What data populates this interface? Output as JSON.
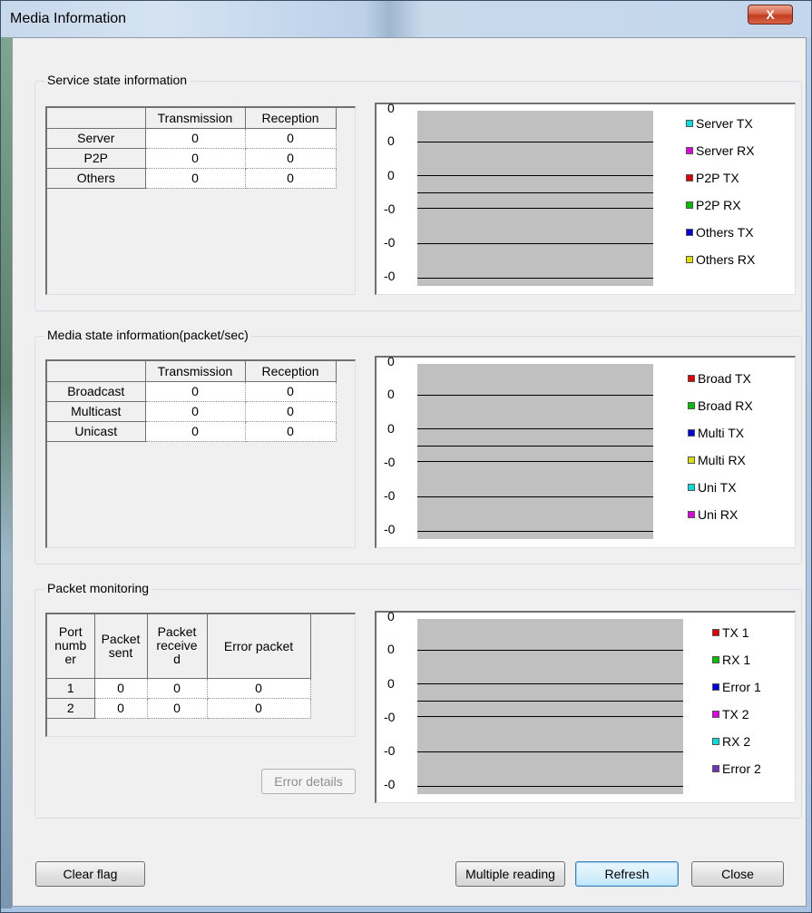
{
  "window": {
    "title": "Media Information",
    "close_glyph": "X"
  },
  "service": {
    "group_title": "Service state information",
    "col_headers": [
      "Transmission",
      "Reception"
    ],
    "rows": [
      {
        "label": "Server",
        "tx": "0",
        "rx": "0"
      },
      {
        "label": "P2P",
        "tx": "0",
        "rx": "0"
      },
      {
        "label": "Others",
        "tx": "0",
        "rx": "0"
      }
    ],
    "chart": {
      "yticks": [
        "0",
        "0",
        "0",
        "-0",
        "-0",
        "-0"
      ],
      "legend": [
        {
          "label": "Server TX",
          "color": "#00e0e0"
        },
        {
          "label": "Server RX",
          "color": "#e000e0"
        },
        {
          "label": "P2P TX",
          "color": "#e00000"
        },
        {
          "label": "P2P RX",
          "color": "#00c000"
        },
        {
          "label": "Others TX",
          "color": "#0000e0"
        },
        {
          "label": "Others RX",
          "color": "#e0e000"
        }
      ]
    }
  },
  "media": {
    "group_title": "Media state information(packet/sec)",
    "col_headers": [
      "Transmission",
      "Reception"
    ],
    "rows": [
      {
        "label": "Broadcast",
        "tx": "0",
        "rx": "0"
      },
      {
        "label": "Multicast",
        "tx": "0",
        "rx": "0"
      },
      {
        "label": "Unicast",
        "tx": "0",
        "rx": "0"
      }
    ],
    "chart": {
      "yticks": [
        "0",
        "0",
        "0",
        "-0",
        "-0",
        "-0"
      ],
      "legend": [
        {
          "label": "Broad TX",
          "color": "#e00000"
        },
        {
          "label": "Broad RX",
          "color": "#00c000"
        },
        {
          "label": "Multi TX",
          "color": "#0000e0"
        },
        {
          "label": "Multi RX",
          "color": "#e0e000"
        },
        {
          "label": "Uni TX",
          "color": "#00e0e0"
        },
        {
          "label": "Uni RX",
          "color": "#e000e0"
        }
      ]
    }
  },
  "packet": {
    "group_title": "Packet monitoring",
    "col_headers": [
      "Port numb er",
      "Packet sent",
      "Packet receive d",
      "Error packet"
    ],
    "rows": [
      {
        "port": "1",
        "sent": "0",
        "received": "0",
        "error": "0"
      },
      {
        "port": "2",
        "sent": "0",
        "received": "0",
        "error": "0"
      }
    ],
    "error_details_label": "Error details",
    "chart": {
      "yticks": [
        "0",
        "0",
        "0",
        "-0",
        "-0",
        "-0"
      ],
      "legend": [
        {
          "label": "TX 1",
          "color": "#e00000"
        },
        {
          "label": "RX 1",
          "color": "#00c000"
        },
        {
          "label": "Error 1",
          "color": "#0000e0"
        },
        {
          "label": "TX 2",
          "color": "#e000e0"
        },
        {
          "label": "RX 2",
          "color": "#00e0e0"
        },
        {
          "label": "Error 2",
          "color": "#7030c0"
        }
      ]
    }
  },
  "buttons": {
    "clear_flag": "Clear flag",
    "multiple_reading": "Multiple reading",
    "refresh": "Refresh",
    "close": "Close"
  }
}
